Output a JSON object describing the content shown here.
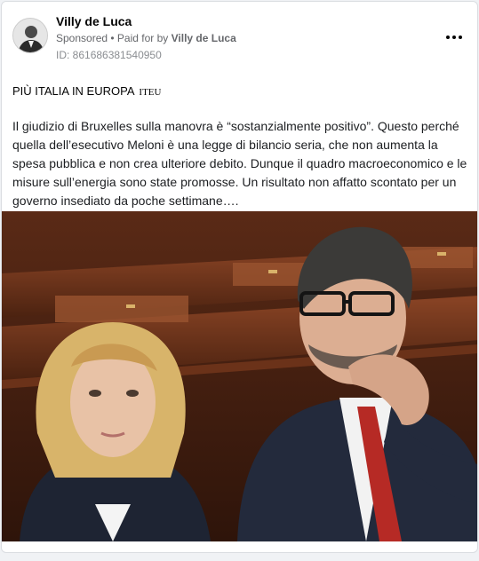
{
  "post": {
    "author_name": "Villy de Luca",
    "sponsored_label": "Sponsored",
    "separator": " • ",
    "paid_for_label": "Paid for by ",
    "paid_for_name": "Villy de Luca",
    "id_line": "ID: 861686381540950",
    "headline": "PIÙ ITALIA IN EUROPA",
    "headline_suffix": "ITEU",
    "body": "Il giudizio di Bruxelles sulla manovra è “sostanzialmente positivo”. Questo perché quella dell’esecutivo Meloni è una legge di bilancio seria, che non aumenta la spesa pubblica e non crea ulteriore debito. Dunque il quadro macroeconomico e le misure sull’energia sono state promosse. Un risultato non affatto scontato per un governo insediato da poche settimane…."
  },
  "icons": {
    "more": "more-horizontal-icon"
  }
}
